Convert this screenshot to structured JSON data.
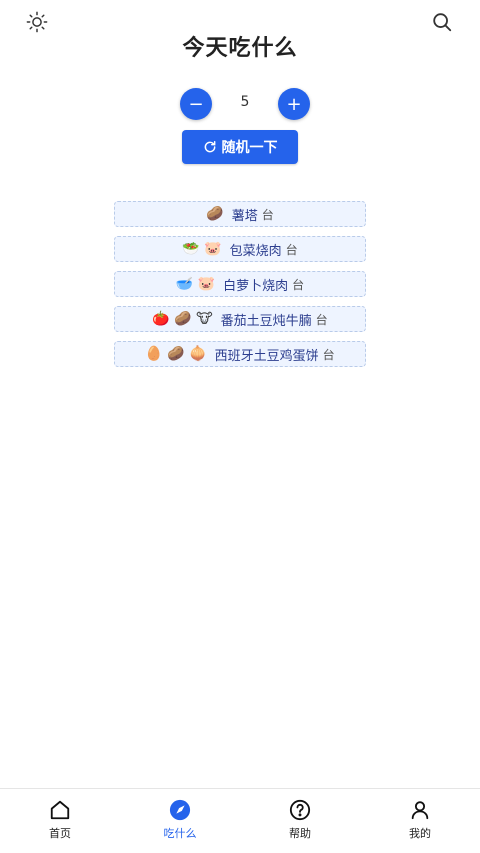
{
  "header": {
    "title": "今天吃什么",
    "icons": {
      "left": "sun-icon",
      "right": "search-icon"
    }
  },
  "stepper": {
    "minus": "−",
    "plus": "+",
    "value": "5"
  },
  "random_button": {
    "label": "随机一下",
    "icon": "refresh-icon"
  },
  "dishes": [
    {
      "emojis": "🥔",
      "name": "薯塔",
      "tail": "台"
    },
    {
      "emojis": "🥗 🐷",
      "name": "包菜烧肉",
      "tail": "台"
    },
    {
      "emojis": "🥣 🐷",
      "name": "白萝卜烧肉",
      "tail": "台"
    },
    {
      "emojis": "🍅 🥔 🐮",
      "name": "番茄土豆炖牛腩",
      "tail": "台"
    },
    {
      "emojis": "🥚 🥔 🧅",
      "name": "西班牙土豆鸡蛋饼",
      "tail": "台"
    }
  ],
  "tabs": [
    {
      "label": "首页",
      "icon": "home-icon"
    },
    {
      "label": "吃什么",
      "icon": "compass-icon",
      "active": true
    },
    {
      "label": "帮助",
      "icon": "help-icon"
    },
    {
      "label": "我的",
      "icon": "user-icon"
    }
  ],
  "colors": {
    "accent": "#2563eb",
    "item_bg": "#eef4ff"
  }
}
